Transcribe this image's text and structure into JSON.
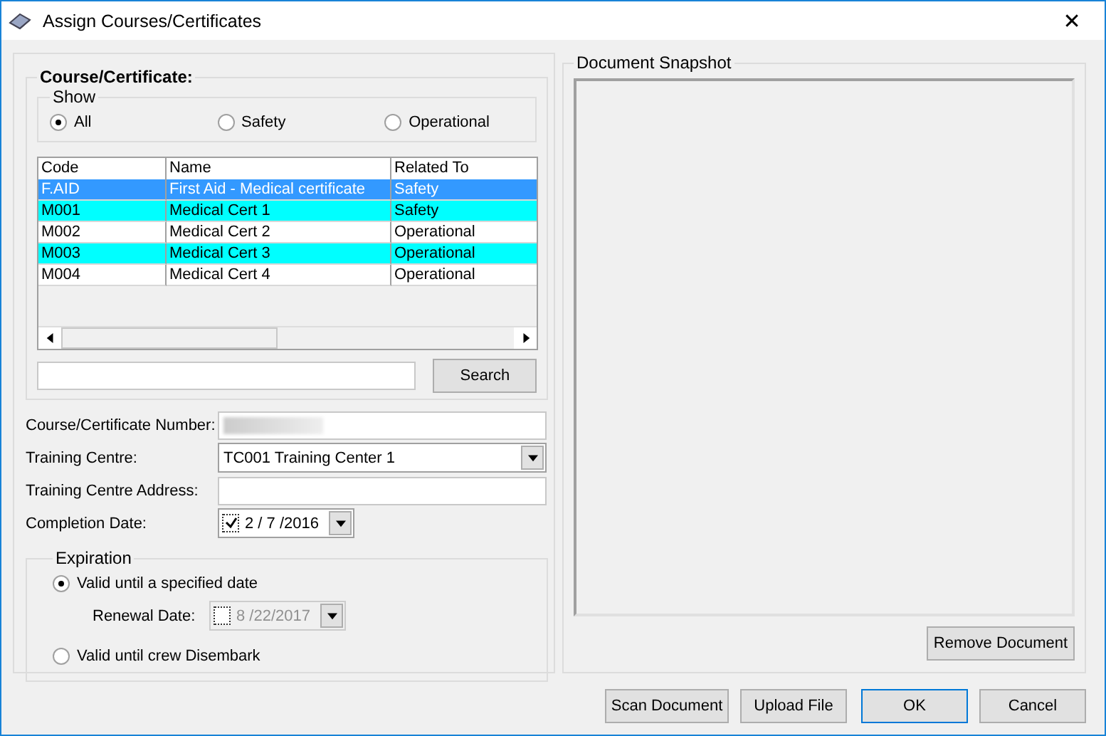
{
  "window": {
    "title": "Assign Courses/Certificates",
    "close": "✕"
  },
  "course_group": {
    "title": "Course/Certificate:",
    "show": {
      "title": "Show",
      "options": [
        {
          "label": "All",
          "selected": true
        },
        {
          "label": "Safety",
          "selected": false
        },
        {
          "label": "Operational",
          "selected": false
        }
      ]
    },
    "table": {
      "columns": [
        "Code",
        "Name",
        "Related To"
      ],
      "rows": [
        {
          "cells": [
            "F.AID",
            "First Aid - Medical certificate",
            "Safety"
          ],
          "selected": true
        },
        {
          "cells": [
            "M001",
            "Medical Cert 1",
            "Safety"
          ],
          "selected": false,
          "color": "#00ffff"
        },
        {
          "cells": [
            "M002",
            "Medical Cert 2",
            "Operational"
          ],
          "selected": false,
          "color": "#ffffff"
        },
        {
          "cells": [
            "M003",
            "Medical Cert 3",
            "Operational"
          ],
          "selected": false,
          "color": "#00ffff"
        },
        {
          "cells": [
            "M004",
            "Medical Cert 4",
            "Operational"
          ],
          "selected": false,
          "color": "#ffffff"
        }
      ]
    },
    "search_button": "Search"
  },
  "form": {
    "number_label": "Course/Certificate Number:",
    "centre_label": "Training Centre:",
    "centre_value": "TC001 Training Center 1",
    "address_label": "Training Centre Address:",
    "completion_label": "Completion Date:",
    "completion_checked": true,
    "completion_date": "2 / 7 /2016"
  },
  "expiration": {
    "title": "Expiration",
    "options": [
      {
        "label": "Valid until a specified date",
        "selected": true
      },
      {
        "label": "Valid until crew Disembark",
        "selected": false
      }
    ],
    "renewal_label": "Renewal Date:",
    "renewal_checked": false,
    "renewal_date": "8 /22/2017",
    "renewal_disabled": true
  },
  "snapshot": {
    "title": "Document Snapshot",
    "remove_button": "Remove Document"
  },
  "buttons": [
    "Scan Document",
    "Upload File",
    "OK",
    "Cancel"
  ]
}
